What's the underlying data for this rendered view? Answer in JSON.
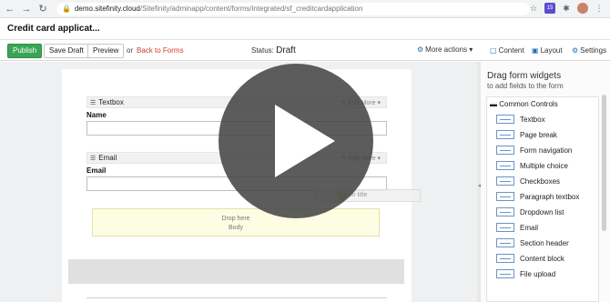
{
  "browser": {
    "back": "←",
    "forward": "→",
    "reload": "↻",
    "url_host": "demo.sitefinity.cloud",
    "url_path": "/Sitefinity/adminapp/content/forms/integrated/sf_creditcardapplication",
    "lock_icon": "lock-icon",
    "star": "☆",
    "ext_badge": "15",
    "puzzle": "✱",
    "menu": "⋮"
  },
  "page": {
    "title": "Credit card applicat..."
  },
  "toolbar": {
    "publish": "Publish",
    "save_draft": "Save Draft",
    "preview": "Preview",
    "or": "or",
    "back_to_forms": "Back to Forms",
    "status_label": "Status:",
    "status_value": "Draft",
    "more_actions": "More actions ▾"
  },
  "side_tabs": {
    "content": "Content",
    "layout": "Layout",
    "settings": "Settings"
  },
  "canvas": {
    "widgets": [
      {
        "header": "Textbox",
        "actions": "✎ Edit  More ▾",
        "label": "Name"
      },
      {
        "header": "Email",
        "actions": "✎ Edit  More ▾",
        "label": "Email"
      }
    ],
    "drop_zone": [
      "Drop here",
      "Body"
    ],
    "ghost_text": "Sign in title"
  },
  "side_panel": {
    "title": "Drag form widgets",
    "subtitle": "to add fields to the form",
    "section": "▬ Common Controls",
    "items": [
      "Textbox",
      "Page break",
      "Form navigation",
      "Multiple choice",
      "Checkboxes",
      "Paragraph textbox",
      "Dropdown list",
      "Email",
      "Section header",
      "Content block",
      "File upload"
    ]
  },
  "colors": {
    "publish": "#3aa655",
    "link": "#d33b2b",
    "accent": "#1e6fb8"
  }
}
